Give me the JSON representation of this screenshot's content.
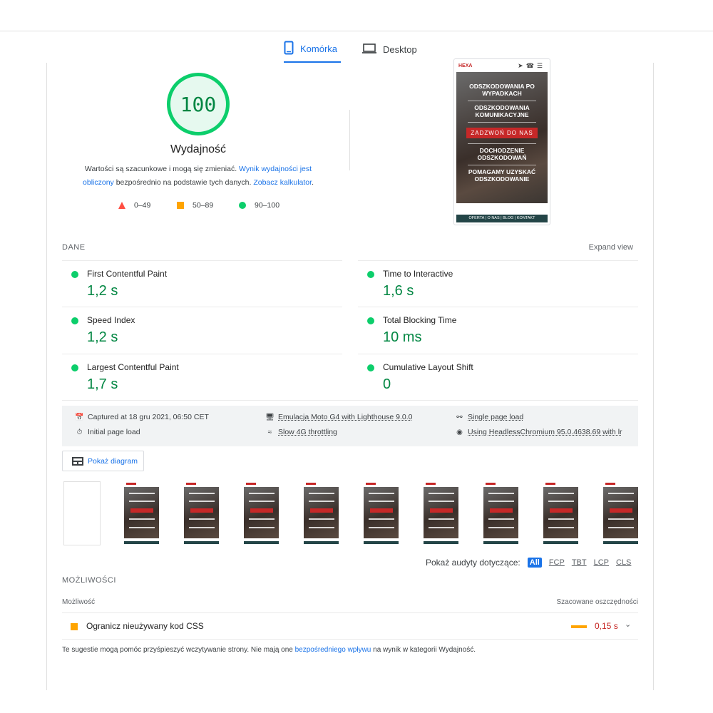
{
  "tabs": [
    {
      "label": "Komórka",
      "icon": "phone-icon",
      "active": true
    },
    {
      "label": "Desktop",
      "icon": "laptop-icon",
      "active": false
    }
  ],
  "score": {
    "value": "100",
    "title": "Wydajność",
    "desc_prefix": "Wartości są szacunkowe i mogą się zmieniać. ",
    "desc_link1": "Wynik wydajności jest obliczony",
    "desc_mid": " bezpośrednio na podstawie tych danych. ",
    "desc_link2": "Zobacz kalkulator",
    "desc_suffix": ".",
    "legend": [
      {
        "range": "0–49",
        "color": "#ff4e42"
      },
      {
        "range": "50–89",
        "color": "#ffa400"
      },
      {
        "range": "90–100",
        "color": "#0cce6b"
      }
    ]
  },
  "phone_preview": {
    "logo": "HEXA",
    "hero_lines": [
      "ODSZKODOWANIA PO WYPADKACH",
      "ODSZKODOWANIA KOMUNIKACYJNE",
      "ZADZWOŃ DO NAS",
      "DOCHODZENIE ODSZKODOWAŃ",
      "POMAGAMY UZYSKAĆ ODSZKODOWANIE"
    ],
    "footer": "OFERTA | O NAS | BLOG | KONTAKT"
  },
  "metrics": {
    "section_label": "DANE",
    "expand_label": "Expand view",
    "items": [
      {
        "name": "First Contentful Paint",
        "value": "1,2 s"
      },
      {
        "name": "Time to Interactive",
        "value": "1,6 s"
      },
      {
        "name": "Speed Index",
        "value": "1,2 s"
      },
      {
        "name": "Total Blocking Time",
        "value": "10 ms"
      },
      {
        "name": "Largest Contentful Paint",
        "value": "1,7 s"
      },
      {
        "name": "Cumulative Layout Shift",
        "value": "0"
      }
    ]
  },
  "meta": {
    "captured": "Captured at 18 gru 2021, 06:50 CET",
    "initial": "Initial page load",
    "emulation": "Emulacja Moto G4 with Lighthouse 9.0.0",
    "throttling": "Slow 4G throttling",
    "single": "Single page load",
    "browser": "Using HeadlessChromium 95.0.4638.69 with lr"
  },
  "diagram_button": "Pokaż diagram",
  "filter": {
    "label": "Pokaż audyty dotyczące:",
    "chips": [
      "All",
      "FCP",
      "TBT",
      "LCP",
      "CLS"
    ]
  },
  "opportunities": {
    "section_label": "MOŻLIWOŚCI",
    "col_left": "Możliwość",
    "col_right": "Szacowane oszczędności",
    "rows": [
      {
        "title": "Ogranicz nieużywany kod CSS",
        "savings": "0,15 s"
      }
    ]
  },
  "footnote": {
    "prefix": "Te sugestie mogą pomóc przyśpieszyć wczytywanie strony. Nie mają one ",
    "link": "bezpośredniego wpływu",
    "suffix": " na wynik w kategorii Wydajność."
  }
}
